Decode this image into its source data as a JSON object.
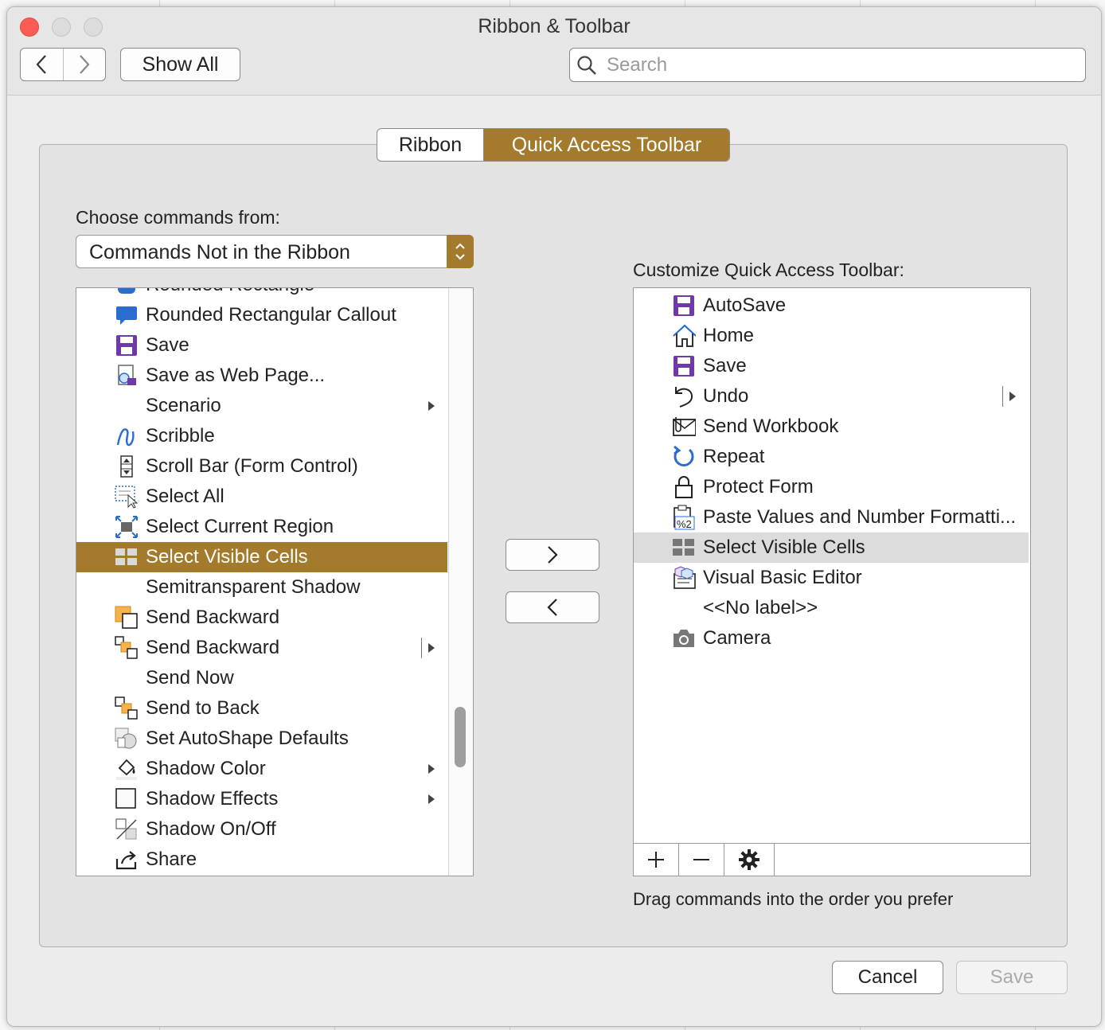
{
  "window": {
    "title": "Ribbon & Toolbar"
  },
  "toolbar": {
    "show_all_label": "Show All",
    "search_placeholder": "Search"
  },
  "tabs": {
    "ribbon": "Ribbon",
    "quick_access": "Quick Access Toolbar",
    "active": "Quick Access Toolbar"
  },
  "left": {
    "label": "Choose commands from:",
    "dropdown_value": "Commands Not in the Ribbon",
    "items": [
      {
        "label": "Rounded Rectangle",
        "icon": "rounded-rectangle-icon"
      },
      {
        "label": "Rounded Rectangular Callout",
        "icon": "callout-icon"
      },
      {
        "label": "Save",
        "icon": "save-icon"
      },
      {
        "label": "Save as Web Page...",
        "icon": "web-page-icon"
      },
      {
        "label": "Scenario",
        "icon": "",
        "submenu": true
      },
      {
        "label": "Scribble",
        "icon": "scribble-icon"
      },
      {
        "label": "Scroll Bar (Form Control)",
        "icon": "scroll-bar-icon"
      },
      {
        "label": "Select All",
        "icon": "select-all-icon"
      },
      {
        "label": "Select Current Region",
        "icon": "select-region-icon"
      },
      {
        "label": "Select Visible Cells",
        "icon": "visible-cells-icon",
        "selected": true
      },
      {
        "label": "Semitransparent Shadow",
        "icon": ""
      },
      {
        "label": "Send Backward",
        "icon": "send-backward-icon"
      },
      {
        "label": "Send Backward",
        "icon": "send-backward-split-icon",
        "submenu": true,
        "split": true
      },
      {
        "label": "Send Now",
        "icon": ""
      },
      {
        "label": "Send to Back",
        "icon": "send-to-back-icon"
      },
      {
        "label": "Set AutoShape Defaults",
        "icon": "autoshape-defaults-icon"
      },
      {
        "label": "Shadow Color",
        "icon": "shadow-color-icon",
        "submenu": true
      },
      {
        "label": "Shadow Effects",
        "icon": "shadow-effects-icon",
        "submenu": true
      },
      {
        "label": "Shadow On/Off",
        "icon": "shadow-toggle-icon"
      },
      {
        "label": "Share",
        "icon": "share-icon"
      }
    ]
  },
  "right": {
    "label": "Customize Quick Access Toolbar:",
    "items": [
      {
        "label": "AutoSave",
        "icon": "autosave-icon"
      },
      {
        "label": "Home",
        "icon": "home-icon"
      },
      {
        "label": "Save",
        "icon": "save-icon"
      },
      {
        "label": "Undo",
        "icon": "undo-icon",
        "submenu": true,
        "split": true
      },
      {
        "label": "Send Workbook",
        "icon": "send-workbook-icon"
      },
      {
        "label": "Repeat",
        "icon": "repeat-icon"
      },
      {
        "label": "Protect Form",
        "icon": "lock-icon"
      },
      {
        "label": "Paste Values and Number Formatti...",
        "icon": "paste-values-icon"
      },
      {
        "label": "Select Visible Cells",
        "icon": "visible-cells-icon",
        "highlighted": true
      },
      {
        "label": "Visual Basic Editor",
        "icon": "vb-editor-icon"
      },
      {
        "label": "<<No label>>",
        "icon": ""
      },
      {
        "label": "Camera",
        "icon": "camera-icon"
      }
    ],
    "hint": "Drag commands into the order you prefer"
  },
  "buttons": {
    "cancel": "Cancel",
    "save": "Save"
  },
  "colors": {
    "accent": "#a47a2c",
    "close": "#fd5c55",
    "save_icon": "#6f3aa8",
    "blue_icon": "#2b6cd2"
  }
}
